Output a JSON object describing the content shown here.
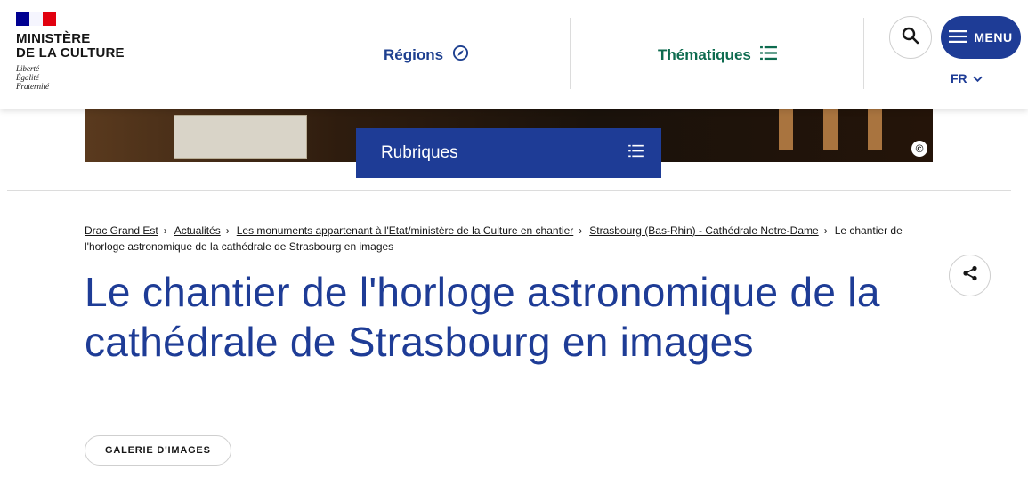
{
  "header": {
    "logo": {
      "name": "MINISTÈRE\nDE LA CULTURE",
      "motto": [
        "Liberté",
        "Égalité",
        "Fraternité"
      ]
    },
    "nav": [
      {
        "label": "Régions",
        "icon": "compass-icon"
      },
      {
        "label": "Thématiques",
        "icon": "list-icon"
      }
    ],
    "search_icon": "search-icon",
    "menu_label": "MENU",
    "lang_label": "FR"
  },
  "banner": {
    "copyright_symbol": "©",
    "rubriques_label": "Rubriques"
  },
  "breadcrumb": [
    {
      "label": "Drac Grand Est",
      "link": true
    },
    {
      "label": "Actualités",
      "link": true
    },
    {
      "label": "Les monuments appartenant à l'Etat/ministère de la Culture en chantier",
      "link": true
    },
    {
      "label": "Strasbourg (Bas-Rhin) - Cathédrale Notre-Dame",
      "link": true
    },
    {
      "label": "Le chantier de l'horloge astronomique de la cathédrale de Strasbourg en images",
      "link": false
    }
  ],
  "page_title": "Le chantier de l'horloge astronomique de la cathédrale de Strasbourg en images",
  "tag_label": "GALERIE D'IMAGES",
  "colors": {
    "primary_blue": "#1e3c96",
    "regions_blue": "#1d3f8f",
    "themes_green": "#0d6b4f",
    "flag_blue": "#000091",
    "flag_red": "#e1000f"
  }
}
